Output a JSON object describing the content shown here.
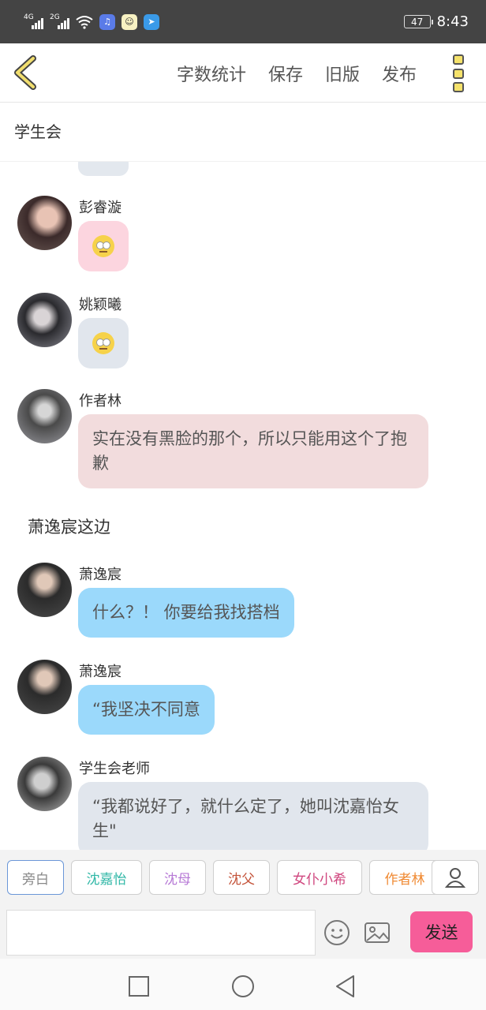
{
  "status_bar": {
    "net1": "4G",
    "net2": "2G",
    "battery": "47",
    "time": "8:43"
  },
  "toolbar": {
    "items": [
      "字数统计",
      "保存",
      "旧版",
      "发布"
    ]
  },
  "subtitle": "学生会",
  "messages": [
    {
      "name": "彭睿漩",
      "emoji": "rolling-eyes-emoji",
      "bubble_color": "#fcd5df"
    },
    {
      "name": "姚颖曦",
      "emoji": "rolling-eyes-emoji",
      "bubble_color": "#e1e6ed"
    },
    {
      "name": "作者林",
      "text": "实在没有黑脸的那个，所以只能用这个了抱歉",
      "bubble_color": "#f2dcdd"
    },
    {
      "name": "萧逸宸",
      "text": "什么？！ 你要给我找搭档",
      "bubble_color": "#9bd9fb"
    },
    {
      "name": "萧逸宸",
      "text": "“我坚决不同意",
      "bubble_color": "#9bd9fb"
    },
    {
      "name": "学生会老师",
      "text": "“我都说好了，就什么定了，她叫沈嘉怡女生\"",
      "bubble_color": "#e1e6ed"
    }
  ],
  "divider": "萧逸宸这边",
  "roles": [
    {
      "label": "旁白",
      "color": "#888888"
    },
    {
      "label": "沈嘉怡",
      "color": "#2fb7a6"
    },
    {
      "label": "沈母",
      "color": "#b77ad6"
    },
    {
      "label": "沈父",
      "color": "#c4543b"
    },
    {
      "label": "女仆小希",
      "color": "#d0477f"
    },
    {
      "label": "作者林",
      "color": "#f08a33"
    }
  ],
  "send_label": "发送"
}
